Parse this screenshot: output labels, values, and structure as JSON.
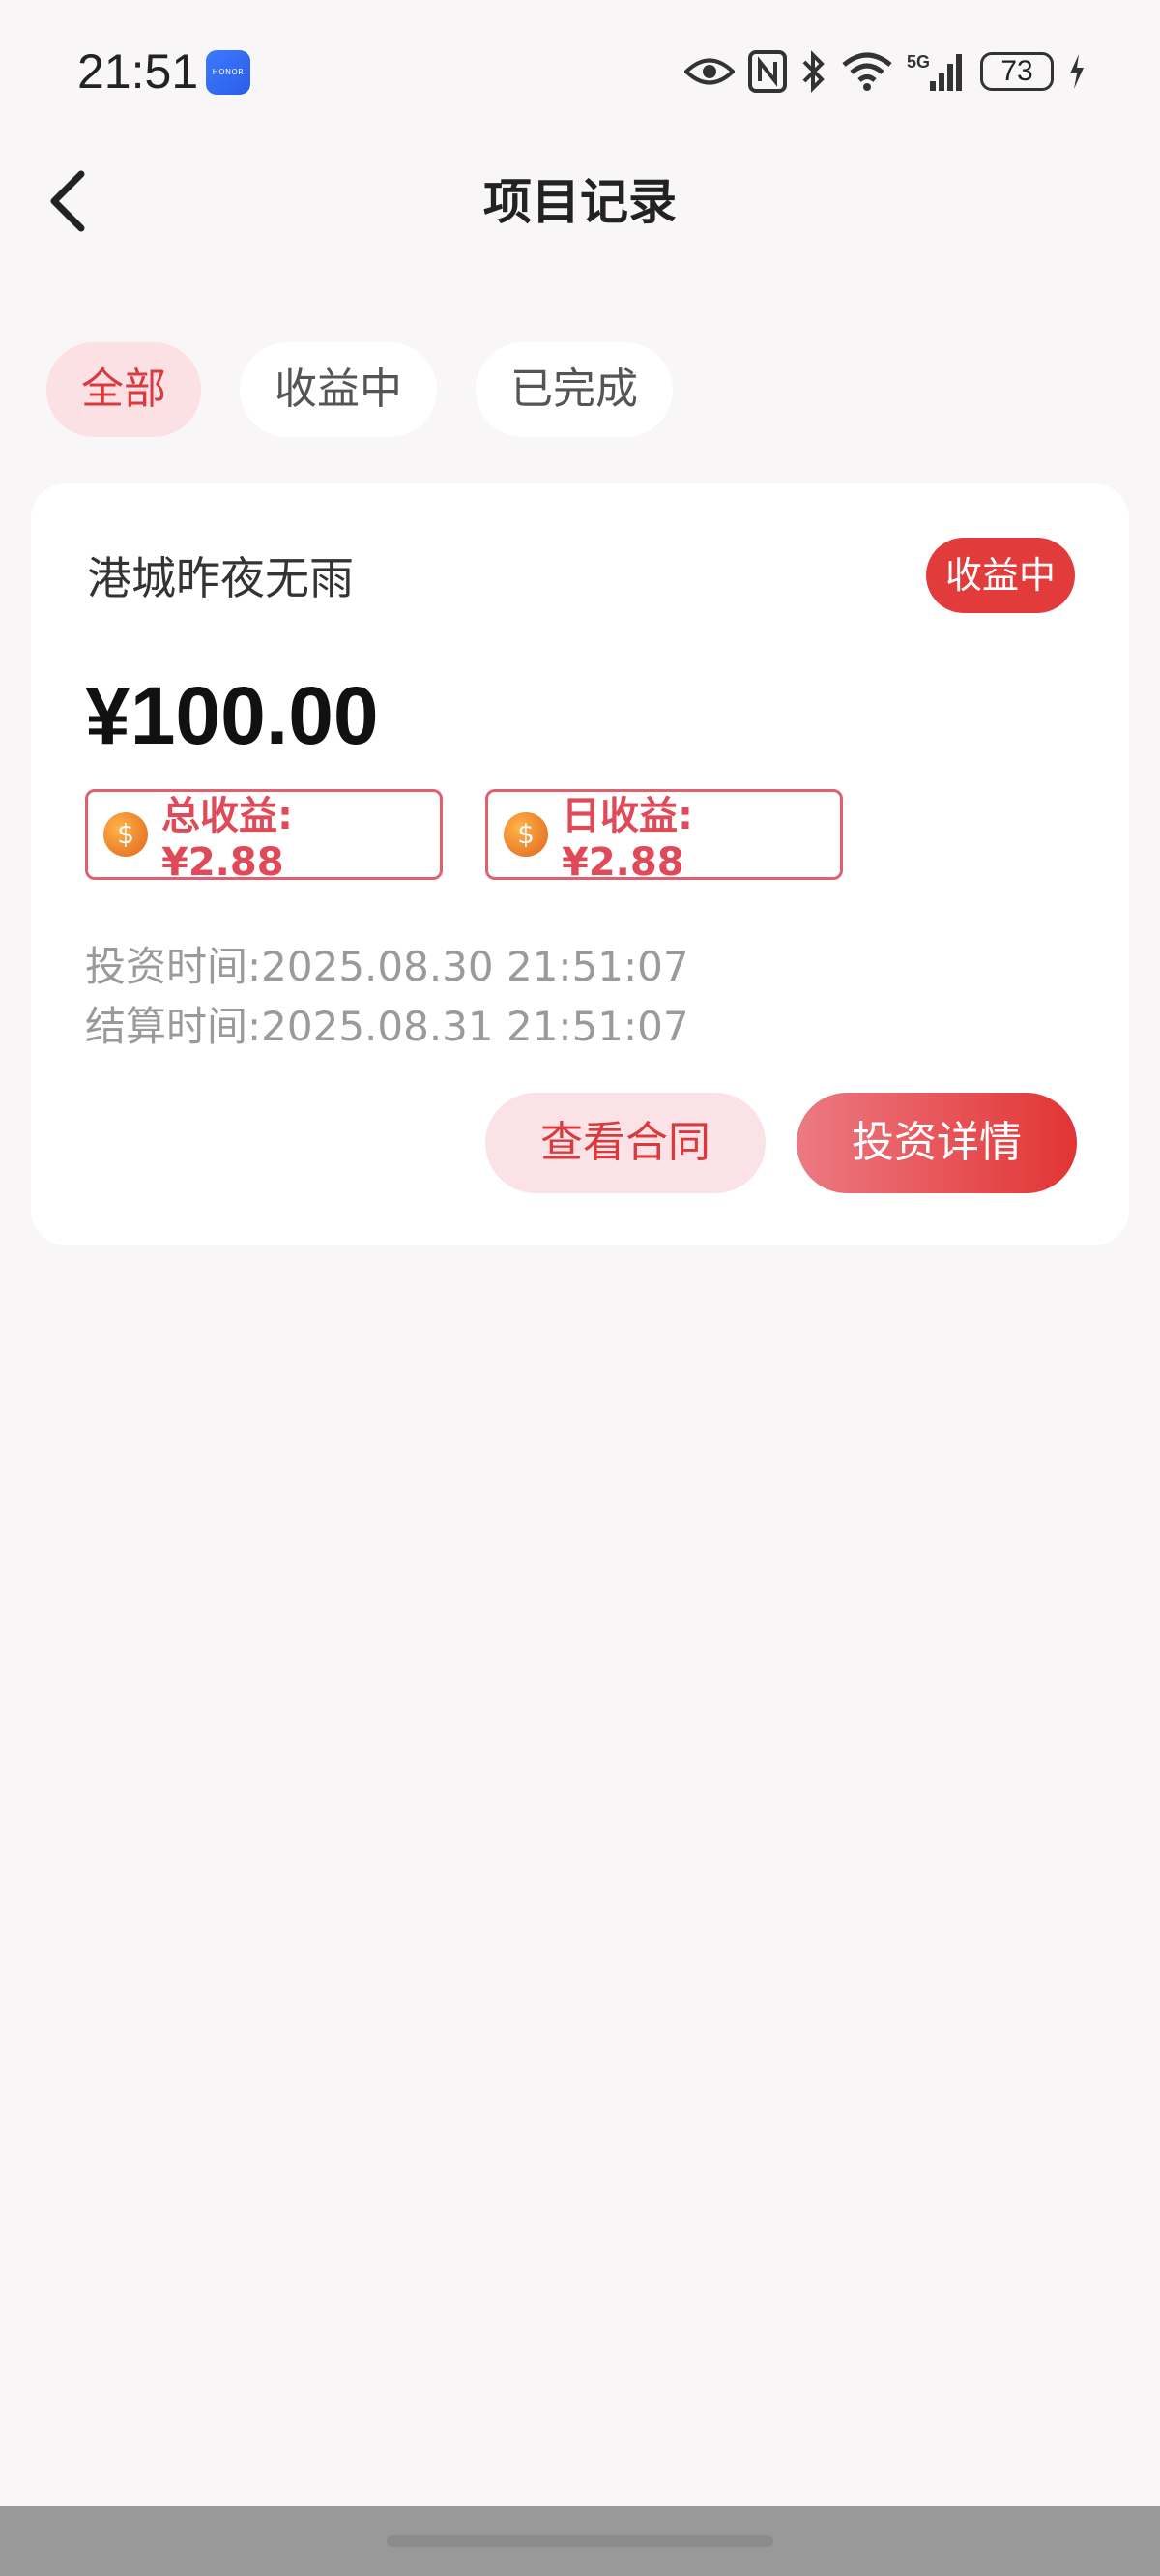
{
  "status_bar": {
    "time": "21:51",
    "app_icon_text": "HONOR",
    "battery": "73"
  },
  "header": {
    "title": "项目记录"
  },
  "tabs": [
    {
      "label": "全部",
      "active": true
    },
    {
      "label": "收益中",
      "active": false
    },
    {
      "label": "已完成",
      "active": false
    }
  ],
  "project": {
    "name": "港城昨夜无雨",
    "status": "收益中",
    "amount": "¥100.00",
    "total_earnings": "总收益: ¥2.88",
    "daily_earnings": "日收益: ¥2.88",
    "invest_time": "投资时间:2025.08.30 21:51:07",
    "settle_time": "结算时间:2025.08.31 21:51:07",
    "contract_button": "查看合同",
    "detail_button": "投资详情"
  },
  "colors": {
    "accent": "#e23b3b",
    "tab_active_bg": "#fbe0e4",
    "background": "#f8f6f7"
  }
}
